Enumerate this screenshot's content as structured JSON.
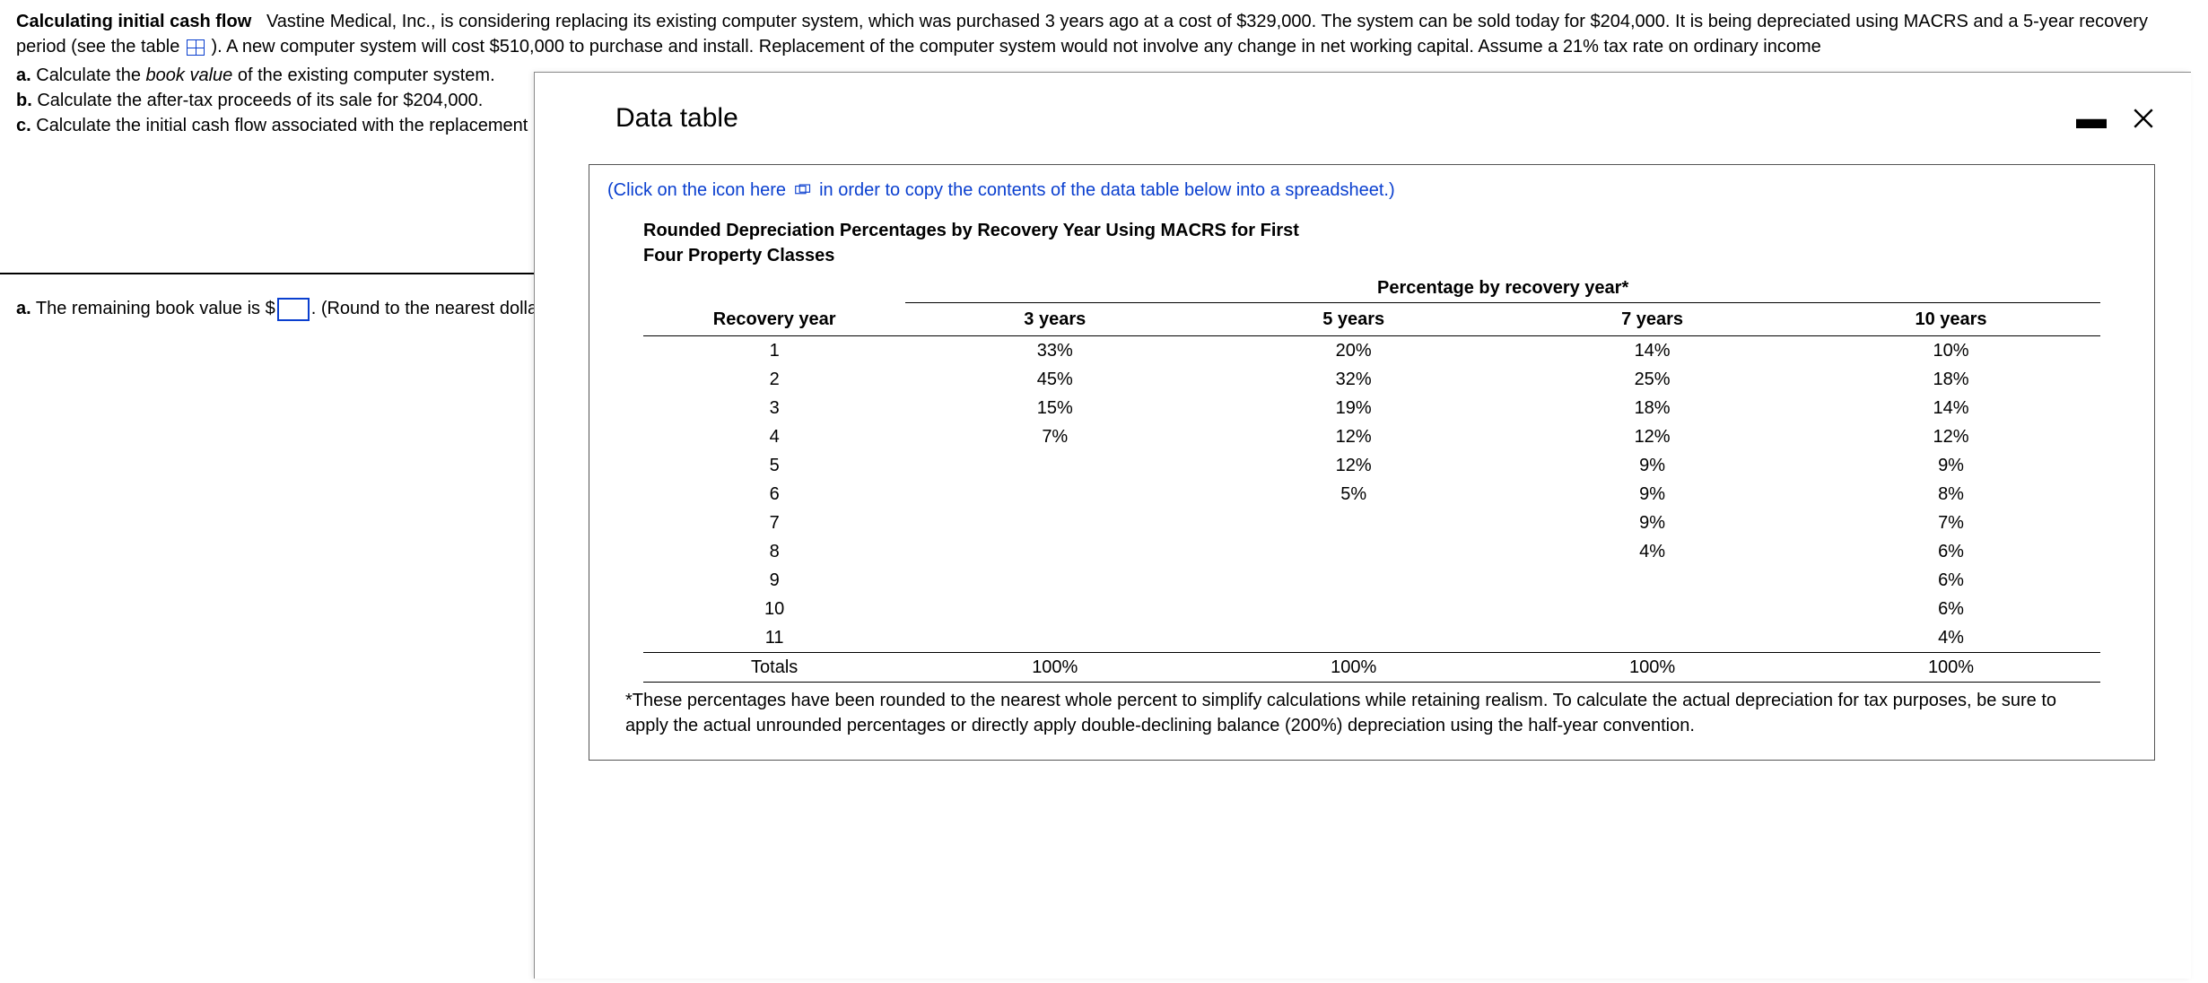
{
  "problem": {
    "title": "Calculating initial cash flow",
    "body_part1": "Vastine Medical, Inc., is considering replacing its existing computer system, which was purchased 3 years ago at a cost of $329,000. The system can be sold today for $204,000. It is being depreciated using MACRS and a 5-year recovery period (see the table ",
    "body_part2": " ). A new computer system will cost $510,000 to purchase and install. Replacement of the computer system would not involve any change in net working capital. Assume a 21% tax rate on ordinary income",
    "qa_label": "a.",
    "qa_text_1": " Calculate the ",
    "qa_text_em": "book value",
    "qa_text_2": " of the existing computer system.",
    "qb_label": "b.",
    "qb_text": " Calculate the after-tax proceeds of its sale for $204,000.",
    "qc_label": "c.",
    "qc_text": " Calculate the initial cash flow associated with the replacement project."
  },
  "answer": {
    "label": "a.",
    "text": " The remaining book value is $",
    "round": ".  (Round to the nearest dollar.)",
    "input_value": ""
  },
  "modal": {
    "title": "Data table",
    "copy_hint_1": "(Click on the icon here ",
    "copy_hint_2": "  in order to copy the contents of the data table below into a spreadsheet.)",
    "caption": "Rounded Depreciation Percentages by Recovery Year Using MACRS for First Four Property Classes",
    "super_header": "Percentage by recovery year*",
    "columns": [
      "Recovery year",
      "3 years",
      "5 years",
      "7 years",
      "10 years"
    ],
    "rows": [
      [
        "1",
        "33%",
        "20%",
        "14%",
        "10%"
      ],
      [
        "2",
        "45%",
        "32%",
        "25%",
        "18%"
      ],
      [
        "3",
        "15%",
        "19%",
        "18%",
        "14%"
      ],
      [
        "4",
        "7%",
        "12%",
        "12%",
        "12%"
      ],
      [
        "5",
        "",
        "12%",
        "9%",
        "9%"
      ],
      [
        "6",
        "",
        "5%",
        "9%",
        "8%"
      ],
      [
        "7",
        "",
        "",
        "9%",
        "7%"
      ],
      [
        "8",
        "",
        "",
        "4%",
        "6%"
      ],
      [
        "9",
        "",
        "",
        "",
        "6%"
      ],
      [
        "10",
        "",
        "",
        "",
        "6%"
      ],
      [
        "11",
        "",
        "",
        "",
        "4%"
      ]
    ],
    "totals": [
      "Totals",
      "100%",
      "100%",
      "100%",
      "100%"
    ],
    "footnote": "*These percentages have been rounded to the nearest whole percent to simplify calculations while retaining realism. To calculate the actual depreciation for tax purposes, be sure to apply the actual unrounded percentages or directly apply double-declining balance (200%) depreciation using the half-year convention."
  },
  "chart_data": {
    "type": "table",
    "title": "Rounded Depreciation Percentages by Recovery Year Using MACRS for First Four Property Classes",
    "columns": [
      "Recovery year",
      "3 years",
      "5 years",
      "7 years",
      "10 years"
    ],
    "rows": [
      [
        "1",
        33,
        20,
        14,
        10
      ],
      [
        "2",
        45,
        32,
        25,
        18
      ],
      [
        "3",
        15,
        19,
        18,
        14
      ],
      [
        "4",
        7,
        12,
        12,
        12
      ],
      [
        "5",
        null,
        12,
        9,
        9
      ],
      [
        "6",
        null,
        5,
        9,
        8
      ],
      [
        "7",
        null,
        null,
        9,
        7
      ],
      [
        "8",
        null,
        null,
        4,
        6
      ],
      [
        "9",
        null,
        null,
        null,
        6
      ],
      [
        "10",
        null,
        null,
        null,
        6
      ],
      [
        "11",
        null,
        null,
        null,
        4
      ]
    ],
    "totals": [
      "Totals",
      100,
      100,
      100,
      100
    ],
    "unit": "percent"
  }
}
